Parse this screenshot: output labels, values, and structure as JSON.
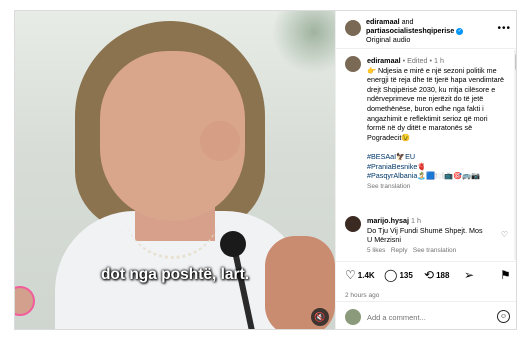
{
  "video": {
    "caption": "dot nga poshtë, lart.",
    "mute_icon": "speaker-muted-icon"
  },
  "header": {
    "username": "ediramaal",
    "and_text": "and",
    "collaborator": "partiasocialisteshqiperise",
    "audio": "Original audio",
    "more_icon": "more-horizontal-icon"
  },
  "post": {
    "username": "ediramaal",
    "edited": "Edited",
    "age": "1 h",
    "text": "👉 Ndjesia e mirë e një sezoni politik me energji të reja dhe të tjerë hapa vendimtarë drejt Shqipërisë 2030, ku rritja cilësore e ndërveprimeve me njerëzit do të jetë domethënëse, buron edhe nga fakti i angazhimit e reflektimit serioz që mori formë në dy ditët e maratonës së Pogradecit😉",
    "hashtags": [
      "#BESAaI🦅EU",
      "#PraniaBesnike🫀",
      "#PasqyrAlbania🏝️🟦🍽️📺🎯🚌📷"
    ],
    "see_translation": "See translation"
  },
  "comment": {
    "username": "marijo.hysaj",
    "age": "1 h",
    "text": "Do Tju Vij Fundi Shumë Shpejt. Mos U Mërzisni",
    "likes": "5 likes",
    "reply": "Reply",
    "see_translation": "See translation"
  },
  "actions": {
    "likes": "1.4K",
    "comments": "135",
    "reposts": "188",
    "time": "2 hours ago"
  },
  "add_comment": {
    "placeholder": "Add a comment..."
  }
}
